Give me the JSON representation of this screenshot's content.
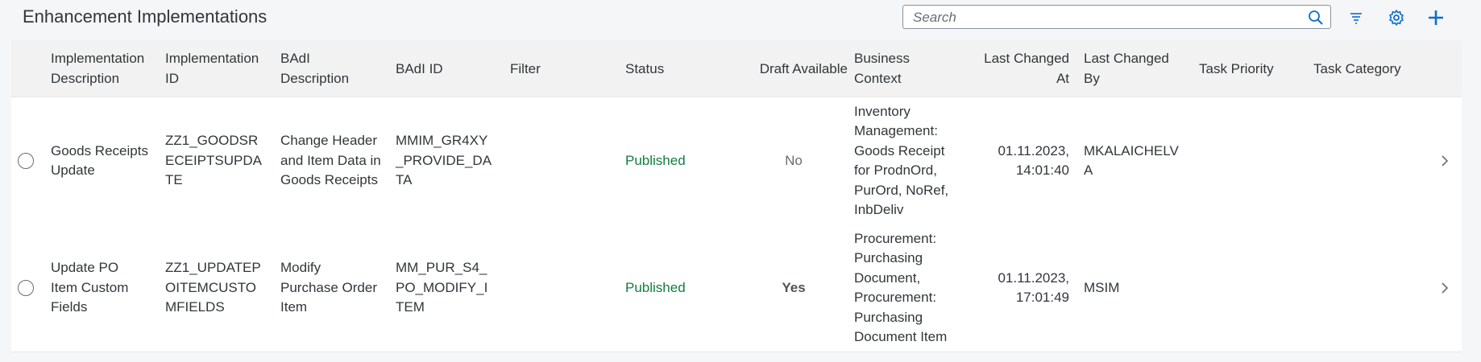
{
  "page": {
    "title": "Enhancement Implementations"
  },
  "search": {
    "placeholder": "Search",
    "value": ""
  },
  "toolbar": {
    "icons": [
      "search-icon",
      "sort-icon",
      "gear-icon",
      "add-icon"
    ]
  },
  "columns": {
    "impl_desc": "Implementation Description",
    "impl_id": "Implementation ID",
    "badi_desc": "BAdI Description",
    "badi_id": "BAdI ID",
    "filter": "Filter",
    "status": "Status",
    "draft": "Draft Available",
    "context": "Business Context",
    "last_changed_at": "Last Changed At",
    "last_changed_by": "Last Changed By",
    "task_priority": "Task Priority",
    "task_category": "Task Category"
  },
  "rows": [
    {
      "impl_desc": "Goods Receipts Update",
      "impl_id": "ZZ1_GOODSRECEIPTSUPDATE",
      "badi_desc": "Change Header and Item Data in Goods Receipts",
      "badi_id": "MMIM_GR4XY_PROVIDE_DATA",
      "filter": "",
      "status": "Published",
      "draft": "No",
      "context": "Inventory Management: Goods Receipt for ProdnOrd, PurOrd, NoRef, InbDeliv",
      "last_changed_at": "01.11.2023, 14:01:40",
      "last_changed_by": "MKALAICHELVA",
      "task_priority": "",
      "task_category": ""
    },
    {
      "impl_desc": "Update PO Item Custom Fields",
      "impl_id": "ZZ1_UPDATEPOITEMCUSTOMFIELDS",
      "badi_desc": "Modify Purchase Order Item",
      "badi_id": "MM_PUR_S4_PO_MODIFY_ITEM",
      "filter": "",
      "status": "Published",
      "draft": "Yes",
      "context": "Procurement: Purchasing Document, Procurement: Purchasing Document Item",
      "last_changed_at": "01.11.2023, 17:01:49",
      "last_changed_by": "MSIM",
      "task_priority": "",
      "task_category": ""
    }
  ],
  "colors": {
    "status_published": "#107e3e",
    "accent": "#0a6ed1"
  }
}
